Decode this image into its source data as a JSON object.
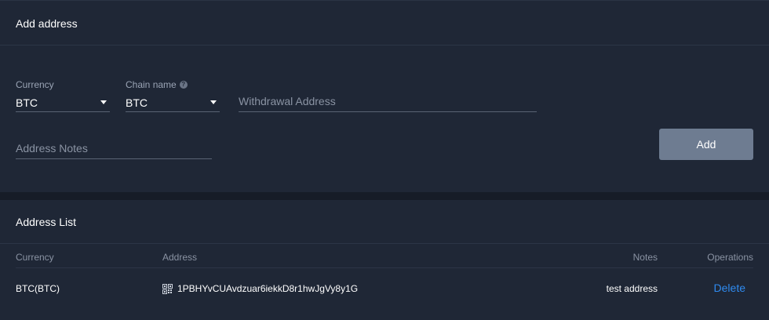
{
  "add_section": {
    "title": "Add address",
    "currency": {
      "label": "Currency",
      "value": "BTC"
    },
    "chain": {
      "label": "Chain name",
      "value": "BTC",
      "info_icon": "info-icon"
    },
    "withdrawal_address": {
      "placeholder": "Withdrawal Address"
    },
    "address_notes": {
      "placeholder": "Address Notes"
    },
    "add_button": "Add"
  },
  "list_section": {
    "title": "Address List",
    "columns": {
      "currency": "Currency",
      "address": "Address",
      "notes": "Notes",
      "operations": "Operations"
    },
    "rows": [
      {
        "currency": "BTC(BTC)",
        "address_icon": "qr-code-icon",
        "address": "1PBHYvCUAvdzuar6iekkD8r1hwJgVy8y1G",
        "notes": "test address",
        "operation": "Delete"
      }
    ]
  },
  "colors": {
    "background": "#1f2736",
    "button": "#6e7c91",
    "link": "#2f8bf0"
  }
}
